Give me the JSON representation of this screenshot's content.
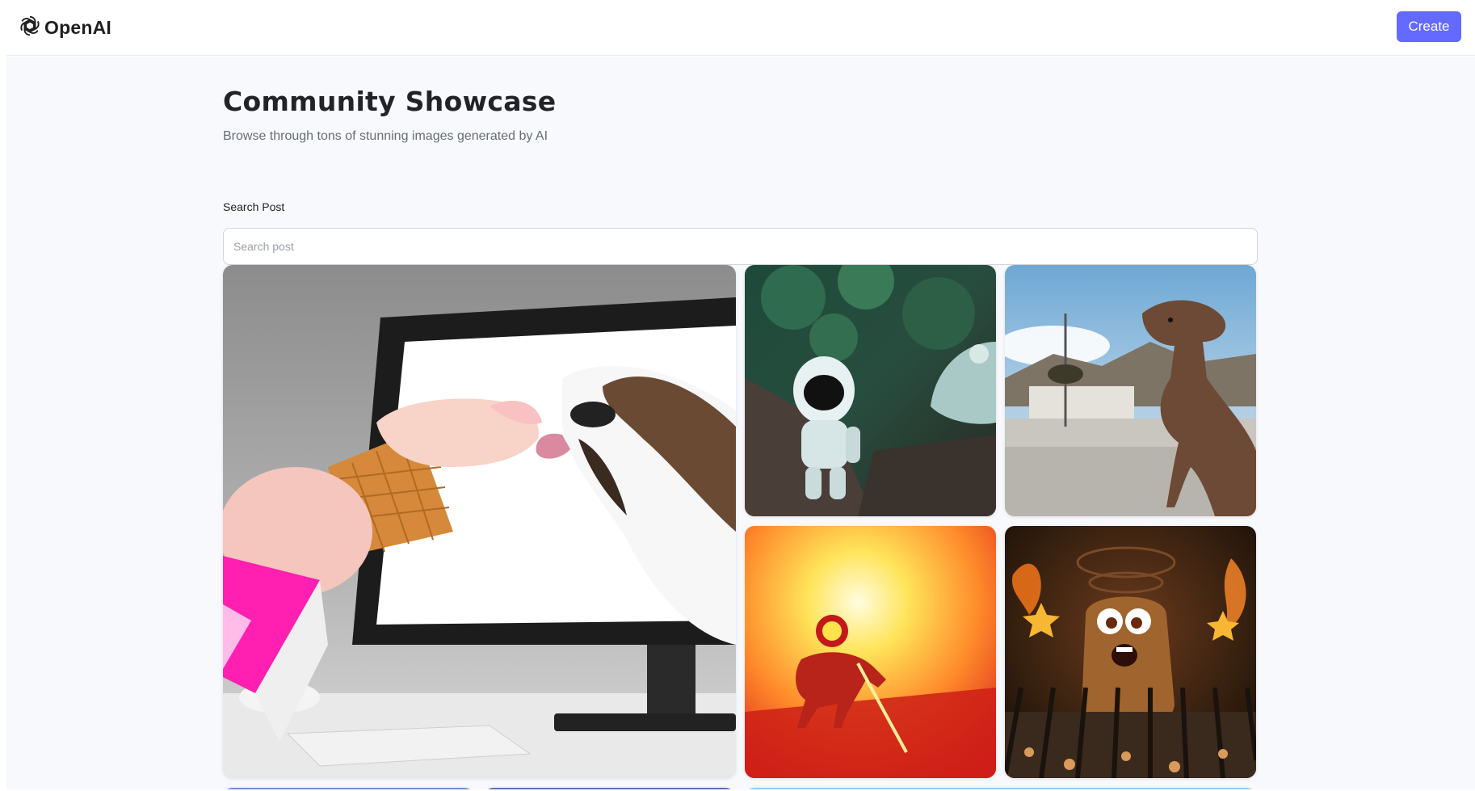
{
  "header": {
    "logo_text": "OpenAI",
    "logo_icon": "openai-logo-icon",
    "create_label": "Create"
  },
  "main": {
    "title": "Community Showcase",
    "subtitle": "Browse through tons of stunning images generated by AI"
  },
  "search": {
    "label": "Search Post",
    "placeholder": "Search post",
    "value": ""
  },
  "colors": {
    "accent": "#6469ff",
    "background": "#f8f9fc",
    "title": "#222328",
    "subtitle": "#666e75"
  },
  "gallery": {
    "images": [
      {
        "name": "dog-licking-ice-cream-image"
      },
      {
        "name": "astronaut-in-forest-image"
      },
      {
        "name": "dinosaur-on-street-image"
      },
      {
        "name": "horse-rider-sunset-image"
      },
      {
        "name": "potato-on-grill-image"
      },
      {
        "name": "partial-image-row-3-a"
      },
      {
        "name": "partial-image-row-3-b"
      },
      {
        "name": "partial-image-row-3-c"
      }
    ]
  }
}
